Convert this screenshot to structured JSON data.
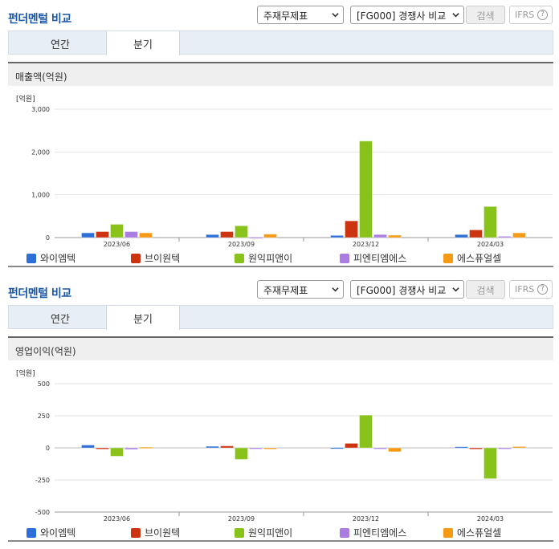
{
  "panels": [
    {
      "title": "펀더멘털 비교",
      "select_statement": "주재무제표",
      "select_compare": "[FG000] 경쟁사 비교",
      "search_label": "검색",
      "ifrs_label": "IFRS",
      "ifrs_help": "?",
      "tabs": [
        {
          "label": "연간",
          "active": false
        },
        {
          "label": "분기",
          "active": true
        }
      ],
      "chart_title": "매출액(억원)"
    },
    {
      "title": "펀더멘털 비교",
      "select_statement": "주재무제표",
      "select_compare": "[FG000] 경쟁사 비교",
      "search_label": "검색",
      "ifrs_label": "IFRS",
      "ifrs_help": "?",
      "tabs": [
        {
          "label": "연간",
          "active": false
        },
        {
          "label": "분기",
          "active": true
        }
      ],
      "chart_title": "영업이익(억원)"
    }
  ],
  "colors": {
    "와이엠텍": "#2d6fd6",
    "브이원텍": "#cc3311",
    "원익피앤이": "#88c21a",
    "피엔티엠에스": "#a97ee0",
    "에스퓨얼셀": "#f59a14"
  },
  "chart_data": [
    {
      "type": "bar",
      "unit_label": "[억원]",
      "categories": [
        "2023/06",
        "2023/09",
        "2023/12",
        "2024/03"
      ],
      "ylim": [
        0,
        3000
      ],
      "yticks": [
        0,
        1000,
        2000,
        3000
      ],
      "ytick_labels": [
        "0",
        "1,000",
        "2,000",
        "3,000"
      ],
      "grid": true,
      "legend_position": "bottom",
      "series": [
        {
          "name": "와이엠텍",
          "values": [
            110,
            70,
            50,
            70
          ]
        },
        {
          "name": "브이원텍",
          "values": [
            140,
            140,
            390,
            180
          ]
        },
        {
          "name": "원익피앤이",
          "values": [
            310,
            275,
            2255,
            725
          ]
        },
        {
          "name": "피엔티엠에스",
          "values": [
            140,
            10,
            70,
            30
          ]
        },
        {
          "name": "에스퓨얼셀",
          "values": [
            110,
            80,
            55,
            110
          ]
        }
      ]
    },
    {
      "type": "bar",
      "unit_label": "[억원]",
      "categories": [
        "2023/06",
        "2023/09",
        "2023/12",
        "2024/03"
      ],
      "ylim": [
        -500,
        500
      ],
      "yticks": [
        -500,
        -250,
        0,
        250,
        500
      ],
      "ytick_labels": [
        "-500",
        "-250",
        "0",
        "250",
        "500"
      ],
      "grid": true,
      "legend_position": "bottom",
      "series": [
        {
          "name": "와이엠텍",
          "values": [
            22,
            12,
            2,
            8
          ]
        },
        {
          "name": "브이원텍",
          "values": [
            -10,
            15,
            35,
            -10
          ]
        },
        {
          "name": "원익피앤이",
          "values": [
            -65,
            -90,
            255,
            -240
          ]
        },
        {
          "name": "피엔티엠에스",
          "values": [
            -12,
            0,
            0,
            0
          ]
        },
        {
          "name": "에스퓨얼셀",
          "values": [
            5,
            -10,
            -30,
            10
          ]
        }
      ]
    }
  ]
}
